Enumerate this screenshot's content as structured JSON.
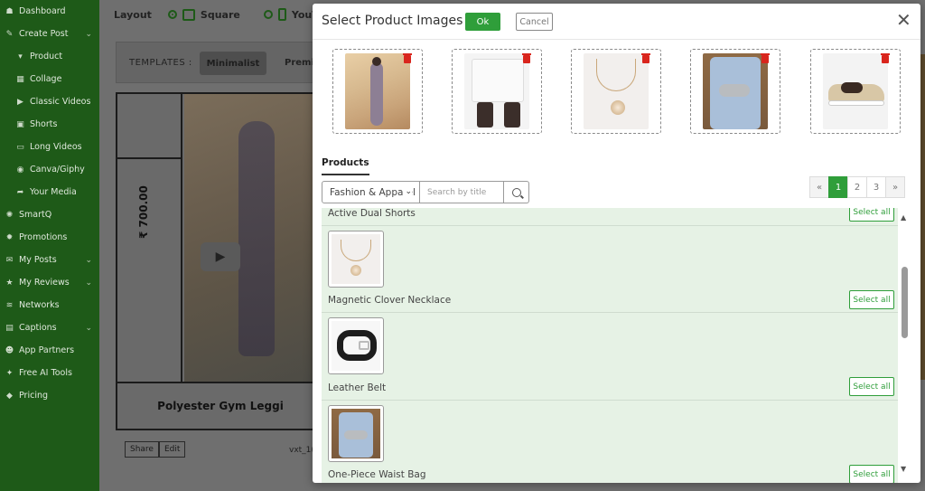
{
  "sidebar": {
    "items": [
      {
        "label": "Dashboard",
        "icon": "dashboard-icon",
        "glyph": "☗",
        "sub": false,
        "chevron": false
      },
      {
        "label": "Create Post",
        "icon": "pencil-icon",
        "glyph": "✎",
        "sub": false,
        "chevron": true
      },
      {
        "label": "Product",
        "icon": "shirt-icon",
        "glyph": "▾",
        "sub": true,
        "chevron": false
      },
      {
        "label": "Collage",
        "icon": "grid-icon",
        "glyph": "▦",
        "sub": true,
        "chevron": false
      },
      {
        "label": "Classic Videos",
        "icon": "play-icon",
        "glyph": "▶",
        "sub": true,
        "chevron": false
      },
      {
        "label": "Shorts",
        "icon": "shorts-icon",
        "glyph": "▣",
        "sub": true,
        "chevron": false
      },
      {
        "label": "Long Videos",
        "icon": "video-icon",
        "glyph": "▭",
        "sub": true,
        "chevron": false
      },
      {
        "label": "Canva/Giphy",
        "icon": "canva-icon",
        "glyph": "◉",
        "sub": true,
        "chevron": false
      },
      {
        "label": "Your Media",
        "icon": "share-icon",
        "glyph": "➦",
        "sub": true,
        "chevron": false
      },
      {
        "label": "SmartQ",
        "icon": "smartq-icon",
        "glyph": "✺",
        "sub": false,
        "chevron": false
      },
      {
        "label": "Promotions",
        "icon": "promotions-icon",
        "glyph": "✹",
        "sub": false,
        "chevron": false
      },
      {
        "label": "My Posts",
        "icon": "posts-icon",
        "glyph": "✉",
        "sub": false,
        "chevron": true
      },
      {
        "label": "My Reviews",
        "icon": "star-icon",
        "glyph": "★",
        "sub": false,
        "chevron": true
      },
      {
        "label": "Networks",
        "icon": "wifi-icon",
        "glyph": "≋",
        "sub": false,
        "chevron": false
      },
      {
        "label": "Captions",
        "icon": "captions-icon",
        "glyph": "▤",
        "sub": false,
        "chevron": true
      },
      {
        "label": "App Partners",
        "icon": "users-icon",
        "glyph": "☻",
        "sub": false,
        "chevron": false
      },
      {
        "label": "Free AI Tools",
        "icon": "tools-icon",
        "glyph": "✦",
        "sub": false,
        "chevron": false
      },
      {
        "label": "Pricing",
        "icon": "tag-icon",
        "glyph": "◆",
        "sub": false,
        "chevron": false
      }
    ]
  },
  "background": {
    "layout_label": "Layout",
    "square_label": "Square",
    "youtube_label": "YouTu",
    "templates_label": "TEMPLATES :",
    "template_active": "Minimalist",
    "template_next": "Premi",
    "preview_price": "₹ 700.00",
    "preview_caption": "Polyester Gym Leggi",
    "share_label": "Share",
    "edit_label": "Edit",
    "post_id": "vxt_1("
  },
  "modal": {
    "title": "Select Product Images",
    "ok_label": "Ok",
    "cancel_label": "Cancel",
    "close_glyph": "✕",
    "selected_images": [
      {
        "name": "selected-image-gym-leggings"
      },
      {
        "name": "selected-image-active-shorts"
      },
      {
        "name": "selected-image-necklace"
      },
      {
        "name": "selected-image-waist-bag"
      },
      {
        "name": "selected-image-sneakers"
      }
    ],
    "products_tab": "Products",
    "category_value": "Fashion & Apparel",
    "search_placeholder": "Search by title",
    "pagination": [
      "«",
      "1",
      "2",
      "3",
      "»"
    ],
    "active_page": "1",
    "products": [
      {
        "title": "Active Dual Shorts",
        "select_label": "Select all"
      },
      {
        "title": "Magnetic Clover Necklace",
        "select_label": "Select all"
      },
      {
        "title": "Leather Belt",
        "select_label": "Select all"
      },
      {
        "title": "One-Piece Waist Bag",
        "select_label": "Select all"
      }
    ]
  },
  "colors": {
    "sidebar": "#1e5a18",
    "accent_green": "#2f9e3a",
    "list_bg": "#e6f2e5",
    "trash_red": "#d9251d"
  }
}
